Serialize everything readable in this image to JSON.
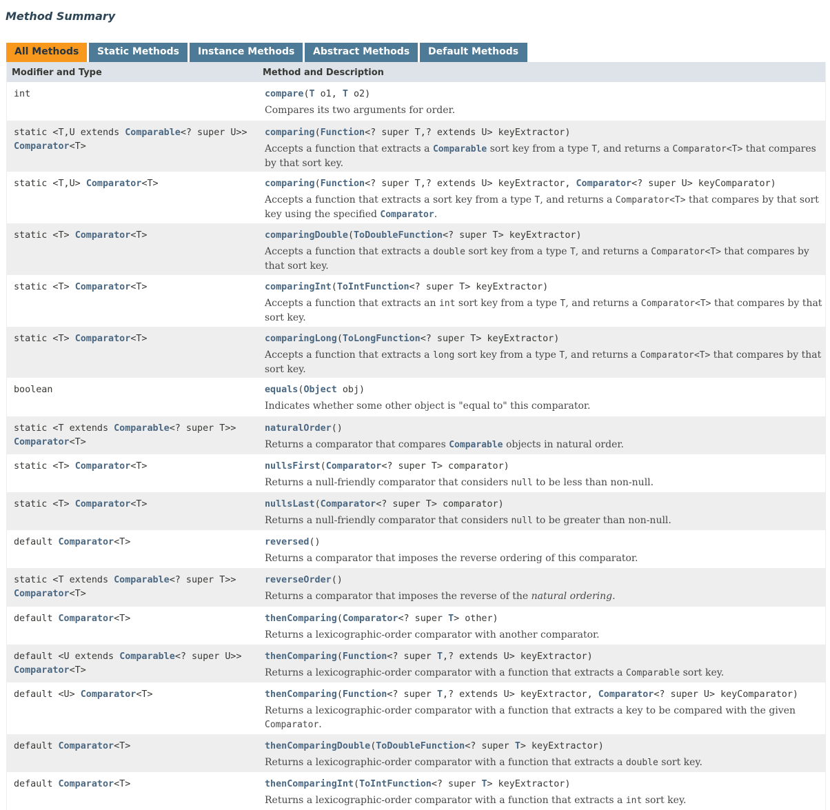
{
  "heading": "Method Summary",
  "tabs": [
    "All Methods",
    "Static Methods",
    "Instance Methods",
    "Abstract Methods",
    "Default Methods"
  ],
  "columns": [
    "Modifier and Type",
    "Method and Description"
  ],
  "rows": [
    {
      "type": [
        [
          "int",
          0
        ]
      ],
      "sig": [
        [
          "compare",
          2
        ],
        [
          "(",
          0
        ],
        [
          "T",
          1
        ],
        [
          " o1, ",
          0
        ],
        [
          "T",
          1
        ],
        [
          " o2)",
          0
        ]
      ],
      "desc": [
        [
          "Compares its two arguments for order.",
          0
        ]
      ]
    },
    {
      "type": [
        [
          "static <T,U extends ",
          0
        ],
        [
          "Comparable",
          1
        ],
        [
          "<? super U>>\n",
          0
        ],
        [
          "Comparator",
          1
        ],
        [
          "<T>",
          0
        ]
      ],
      "sig": [
        [
          "comparing",
          2
        ],
        [
          "(",
          0
        ],
        [
          "Function",
          1
        ],
        [
          "<? super T,? extends U> keyExtractor)",
          0
        ]
      ],
      "desc": [
        [
          "Accepts a function that extracts a ",
          0
        ],
        [
          "Comparable",
          1
        ],
        [
          " sort key from a type ",
          0
        ],
        [
          "T",
          3
        ],
        [
          ", and returns a ",
          0
        ],
        [
          "Comparator<T>",
          3
        ],
        [
          " that compares by that sort key.",
          0
        ]
      ]
    },
    {
      "type": [
        [
          "static <T,U> ",
          0
        ],
        [
          "Comparator",
          1
        ],
        [
          "<T>",
          0
        ]
      ],
      "sig": [
        [
          "comparing",
          2
        ],
        [
          "(",
          0
        ],
        [
          "Function",
          1
        ],
        [
          "<? super T,? extends U> keyExtractor, ",
          0
        ],
        [
          "Comparator",
          1
        ],
        [
          "<? super U> keyComparator)",
          0
        ]
      ],
      "desc": [
        [
          "Accepts a function that extracts a sort key from a type ",
          0
        ],
        [
          "T",
          3
        ],
        [
          ", and returns a ",
          0
        ],
        [
          "Comparator<T>",
          3
        ],
        [
          " that compares by that sort key using the specified ",
          0
        ],
        [
          "Comparator",
          1
        ],
        [
          ".",
          0
        ]
      ]
    },
    {
      "type": [
        [
          "static <T> ",
          0
        ],
        [
          "Comparator",
          1
        ],
        [
          "<T>",
          0
        ]
      ],
      "sig": [
        [
          "comparingDouble",
          2
        ],
        [
          "(",
          0
        ],
        [
          "ToDoubleFunction",
          1
        ],
        [
          "<? super T> keyExtractor)",
          0
        ]
      ],
      "desc": [
        [
          "Accepts a function that extracts a ",
          0
        ],
        [
          "double",
          3
        ],
        [
          " sort key from a type ",
          0
        ],
        [
          "T",
          3
        ],
        [
          ", and returns a ",
          0
        ],
        [
          "Comparator<T>",
          3
        ],
        [
          " that compares by that sort key.",
          0
        ]
      ]
    },
    {
      "type": [
        [
          "static <T> ",
          0
        ],
        [
          "Comparator",
          1
        ],
        [
          "<T>",
          0
        ]
      ],
      "sig": [
        [
          "comparingInt",
          2
        ],
        [
          "(",
          0
        ],
        [
          "ToIntFunction",
          1
        ],
        [
          "<? super T> keyExtractor)",
          0
        ]
      ],
      "desc": [
        [
          "Accepts a function that extracts an ",
          0
        ],
        [
          "int",
          3
        ],
        [
          " sort key from a type ",
          0
        ],
        [
          "T",
          3
        ],
        [
          ", and returns a ",
          0
        ],
        [
          "Comparator<T>",
          3
        ],
        [
          " that compares by that sort key.",
          0
        ]
      ]
    },
    {
      "type": [
        [
          "static <T> ",
          0
        ],
        [
          "Comparator",
          1
        ],
        [
          "<T>",
          0
        ]
      ],
      "sig": [
        [
          "comparingLong",
          2
        ],
        [
          "(",
          0
        ],
        [
          "ToLongFunction",
          1
        ],
        [
          "<? super T> keyExtractor)",
          0
        ]
      ],
      "desc": [
        [
          "Accepts a function that extracts a ",
          0
        ],
        [
          "long",
          3
        ],
        [
          " sort key from a type ",
          0
        ],
        [
          "T",
          3
        ],
        [
          ", and returns a ",
          0
        ],
        [
          "Comparator<T>",
          3
        ],
        [
          " that compares by that sort key.",
          0
        ]
      ]
    },
    {
      "type": [
        [
          "boolean",
          0
        ]
      ],
      "sig": [
        [
          "equals",
          2
        ],
        [
          "(",
          0
        ],
        [
          "Object",
          1
        ],
        [
          " obj)",
          0
        ]
      ],
      "desc": [
        [
          "Indicates whether some other object is \"equal to\" this comparator.",
          0
        ]
      ]
    },
    {
      "type": [
        [
          "static <T extends ",
          0
        ],
        [
          "Comparable",
          1
        ],
        [
          "<? super T>>\n",
          0
        ],
        [
          "Comparator",
          1
        ],
        [
          "<T>",
          0
        ]
      ],
      "sig": [
        [
          "naturalOrder",
          2
        ],
        [
          "()",
          0
        ]
      ],
      "desc": [
        [
          "Returns a comparator that compares ",
          0
        ],
        [
          "Comparable",
          1
        ],
        [
          " objects in natural order.",
          0
        ]
      ]
    },
    {
      "type": [
        [
          "static <T> ",
          0
        ],
        [
          "Comparator",
          1
        ],
        [
          "<T>",
          0
        ]
      ],
      "sig": [
        [
          "nullsFirst",
          2
        ],
        [
          "(",
          0
        ],
        [
          "Comparator",
          1
        ],
        [
          "<? super T> comparator)",
          0
        ]
      ],
      "desc": [
        [
          "Returns a null-friendly comparator that considers ",
          0
        ],
        [
          "null",
          3
        ],
        [
          " to be less than non-null.",
          0
        ]
      ]
    },
    {
      "type": [
        [
          "static <T> ",
          0
        ],
        [
          "Comparator",
          1
        ],
        [
          "<T>",
          0
        ]
      ],
      "sig": [
        [
          "nullsLast",
          2
        ],
        [
          "(",
          0
        ],
        [
          "Comparator",
          1
        ],
        [
          "<? super T> comparator)",
          0
        ]
      ],
      "desc": [
        [
          "Returns a null-friendly comparator that considers ",
          0
        ],
        [
          "null",
          3
        ],
        [
          " to be greater than non-null.",
          0
        ]
      ]
    },
    {
      "type": [
        [
          "default ",
          0
        ],
        [
          "Comparator",
          1
        ],
        [
          "<T>",
          0
        ]
      ],
      "sig": [
        [
          "reversed",
          2
        ],
        [
          "()",
          0
        ]
      ],
      "desc": [
        [
          "Returns a comparator that imposes the reverse ordering of this comparator.",
          0
        ]
      ]
    },
    {
      "type": [
        [
          "static <T extends ",
          0
        ],
        [
          "Comparable",
          1
        ],
        [
          "<? super T>>\n",
          0
        ],
        [
          "Comparator",
          1
        ],
        [
          "<T>",
          0
        ]
      ],
      "sig": [
        [
          "reverseOrder",
          2
        ],
        [
          "()",
          0
        ]
      ],
      "desc": [
        [
          "Returns a comparator that imposes the reverse of the ",
          0
        ],
        [
          "natural ordering",
          4
        ],
        [
          ".",
          0
        ]
      ]
    },
    {
      "type": [
        [
          "default ",
          0
        ],
        [
          "Comparator",
          1
        ],
        [
          "<T>",
          0
        ]
      ],
      "sig": [
        [
          "thenComparing",
          2
        ],
        [
          "(",
          0
        ],
        [
          "Comparator",
          1
        ],
        [
          "<? super ",
          0
        ],
        [
          "T",
          1
        ],
        [
          "> other)",
          0
        ]
      ],
      "desc": [
        [
          "Returns a lexicographic-order comparator with another comparator.",
          0
        ]
      ]
    },
    {
      "type": [
        [
          "default <U extends ",
          0
        ],
        [
          "Comparable",
          1
        ],
        [
          "<? super U>>\n",
          0
        ],
        [
          "Comparator",
          1
        ],
        [
          "<T>",
          0
        ]
      ],
      "sig": [
        [
          "thenComparing",
          2
        ],
        [
          "(",
          0
        ],
        [
          "Function",
          1
        ],
        [
          "<? super ",
          0
        ],
        [
          "T",
          1
        ],
        [
          ",? extends U> keyExtractor)",
          0
        ]
      ],
      "desc": [
        [
          "Returns a lexicographic-order comparator with a function that extracts a ",
          0
        ],
        [
          "Comparable",
          3
        ],
        [
          " sort key.",
          0
        ]
      ]
    },
    {
      "type": [
        [
          "default <U> ",
          0
        ],
        [
          "Comparator",
          1
        ],
        [
          "<T>",
          0
        ]
      ],
      "sig": [
        [
          "thenComparing",
          2
        ],
        [
          "(",
          0
        ],
        [
          "Function",
          1
        ],
        [
          "<? super ",
          0
        ],
        [
          "T",
          1
        ],
        [
          ",? extends U> keyExtractor, ",
          0
        ],
        [
          "Comparator",
          1
        ],
        [
          "<? super U> keyComparator)",
          0
        ]
      ],
      "desc": [
        [
          "Returns a lexicographic-order comparator with a function that extracts a key to be compared with the given ",
          0
        ],
        [
          "Comparator",
          3
        ],
        [
          ".",
          0
        ]
      ]
    },
    {
      "type": [
        [
          "default ",
          0
        ],
        [
          "Comparator",
          1
        ],
        [
          "<T>",
          0
        ]
      ],
      "sig": [
        [
          "thenComparingDouble",
          2
        ],
        [
          "(",
          0
        ],
        [
          "ToDoubleFunction",
          1
        ],
        [
          "<? super ",
          0
        ],
        [
          "T",
          1
        ],
        [
          "> keyExtractor)",
          0
        ]
      ],
      "desc": [
        [
          "Returns a lexicographic-order comparator with a function that extracts a ",
          0
        ],
        [
          "double",
          3
        ],
        [
          " sort key.",
          0
        ]
      ]
    },
    {
      "type": [
        [
          "default ",
          0
        ],
        [
          "Comparator",
          1
        ],
        [
          "<T>",
          0
        ]
      ],
      "sig": [
        [
          "thenComparingInt",
          2
        ],
        [
          "(",
          0
        ],
        [
          "ToIntFunction",
          1
        ],
        [
          "<? super ",
          0
        ],
        [
          "T",
          1
        ],
        [
          "> keyExtractor)",
          0
        ]
      ],
      "desc": [
        [
          "Returns a lexicographic-order comparator with a function that extracts a ",
          0
        ],
        [
          "int",
          3
        ],
        [
          " sort key.",
          0
        ]
      ]
    }
  ]
}
